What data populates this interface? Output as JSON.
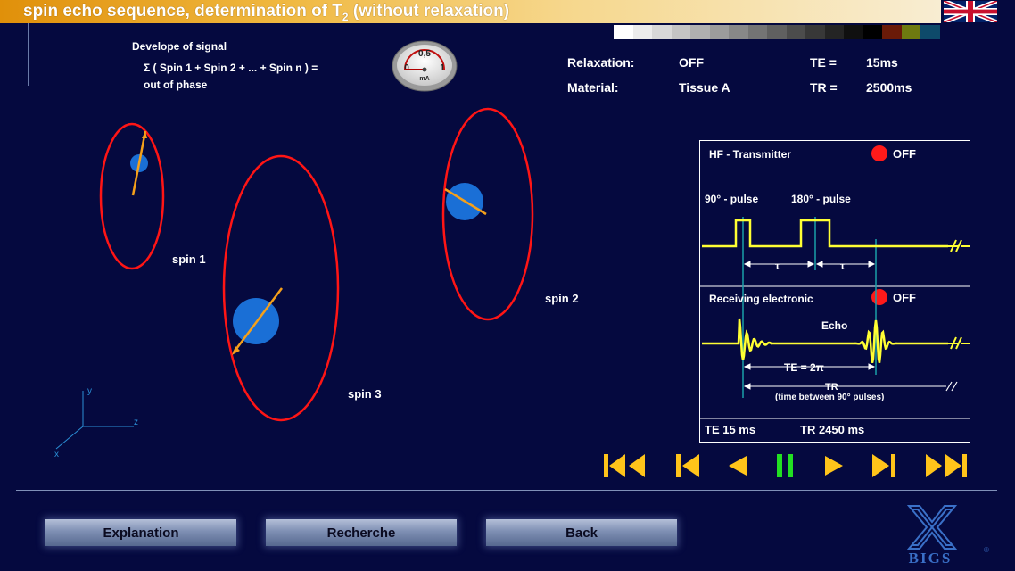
{
  "header": {
    "title_main": "spin echo sequence, determination of T",
    "title_sub": "2",
    "title_rest": " (without relaxation)",
    "language_flag": "uk-flag-icon"
  },
  "swatches": [
    "#ffffff",
    "#ececec",
    "#d8d8d8",
    "#c4c4c4",
    "#b0b0b0",
    "#9c9c9c",
    "#888888",
    "#747474",
    "#606060",
    "#4c4c4c",
    "#383838",
    "#242424",
    "#101010",
    "#000000",
    "#6a1a08",
    "#6e7a10",
    "#0e4a6a"
  ],
  "signal": {
    "title": "Develope of signal",
    "line1": "Σ ( Spin 1 + Spin 2 + ... + Spin n ) =",
    "line2": "out of phase"
  },
  "gauge": {
    "top_value": "0,5",
    "left_value": "0",
    "right_value": "1",
    "unit": "mA",
    "level": 0
  },
  "params": {
    "relaxation_label": "Relaxation:",
    "relaxation_value": "OFF",
    "material_label": "Material:",
    "material_value": "Tissue A",
    "te_label": "TE =",
    "te_value": "15ms",
    "tr_label": "TR =",
    "tr_value": "2500ms"
  },
  "spins": [
    {
      "label": "spin 1"
    },
    {
      "label": "spin 2"
    },
    {
      "label": "spin 3"
    }
  ],
  "axes": {
    "x": "x",
    "y": "y",
    "z": "z"
  },
  "panel": {
    "hf_label": "HF - Transmitter",
    "hf_status": "OFF",
    "pulse90": "90° - pulse",
    "pulse180": "180° - pulse",
    "tau": "τ",
    "recv_label": "Receiving electronic",
    "recv_status": "OFF",
    "echo": "Echo",
    "te_eq": "TE = 2π",
    "tr": "TR",
    "tr_note": "(time between 90° pulses)",
    "te_footer": "TE  15 ms",
    "tr_footer": "TR  2450 ms",
    "colors": {
      "signal": "#ffff33",
      "marker": "#19a0a8",
      "led": "#ff1a1a"
    }
  },
  "controls": [
    "first-icon",
    "step-back-icon",
    "play-backward-icon",
    "pause-icon",
    "play-forward-icon",
    "step-forward-icon",
    "last-icon"
  ],
  "buttons": {
    "explanation": "Explanation",
    "recherche": "Recherche",
    "back": "Back"
  },
  "logo": {
    "text": "BIGS",
    "mark": "®"
  }
}
